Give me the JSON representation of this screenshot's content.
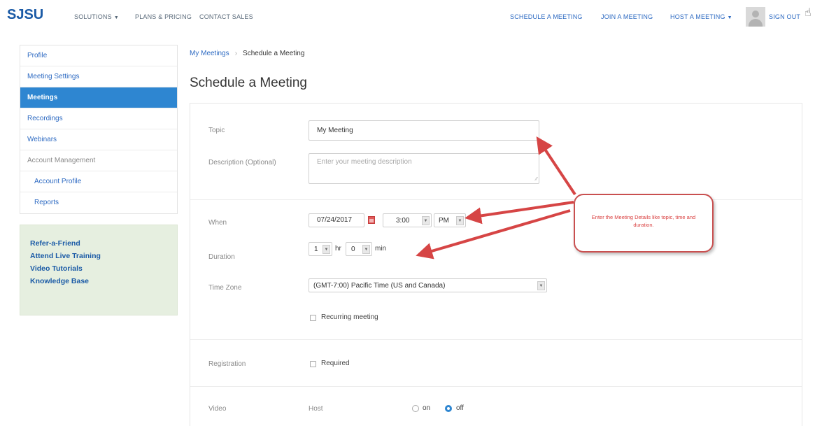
{
  "topnav": {
    "logo": "SJSU",
    "items_left": [
      "SOLUTIONS",
      "PLANS & PRICING",
      "CONTACT SALES"
    ],
    "items_right": [
      "SCHEDULE A MEETING",
      "JOIN A MEETING",
      "HOST A MEETING",
      "SIGN OUT"
    ],
    "caret": "▼"
  },
  "sidebar": {
    "items": [
      {
        "label": "Profile"
      },
      {
        "label": "Meeting Settings"
      },
      {
        "label": "Meetings",
        "active": true
      },
      {
        "label": "Recordings"
      },
      {
        "label": "Webinars"
      },
      {
        "label": "Account Management"
      },
      {
        "label": "Account Profile"
      },
      {
        "label": "Reports"
      }
    ],
    "promo": [
      "Refer-a-Friend",
      "Attend Live Training",
      "Video Tutorials",
      "Knowledge Base"
    ]
  },
  "breadcrumb": {
    "link": "My Meetings",
    "sep": "›",
    "current": "Schedule a Meeting"
  },
  "page_title": "Schedule a Meeting",
  "form": {
    "topic": {
      "label": "Topic",
      "value": "My Meeting"
    },
    "description": {
      "label": "Description (Optional)",
      "placeholder": "Enter your meeting description"
    },
    "when": {
      "label": "When",
      "date": "07/24/2017",
      "time": "3:00",
      "ampm": "PM"
    },
    "duration": {
      "label": "Duration",
      "hours": "1",
      "hr_unit": "hr",
      "minutes": "0",
      "min_unit": "min"
    },
    "timezone": {
      "label": "Time Zone",
      "value": "(GMT-7:00) Pacific Time (US and Canada)"
    },
    "recurring": {
      "label": "Recurring meeting"
    },
    "registration": {
      "label": "Registration",
      "option": "Required"
    },
    "video": {
      "label": "Video",
      "host_label": "Host",
      "on": "on",
      "off": "off"
    }
  },
  "annotation": {
    "text": "Enter the Meeting Details like topic, time and duration.",
    "color": "#c95050"
  }
}
